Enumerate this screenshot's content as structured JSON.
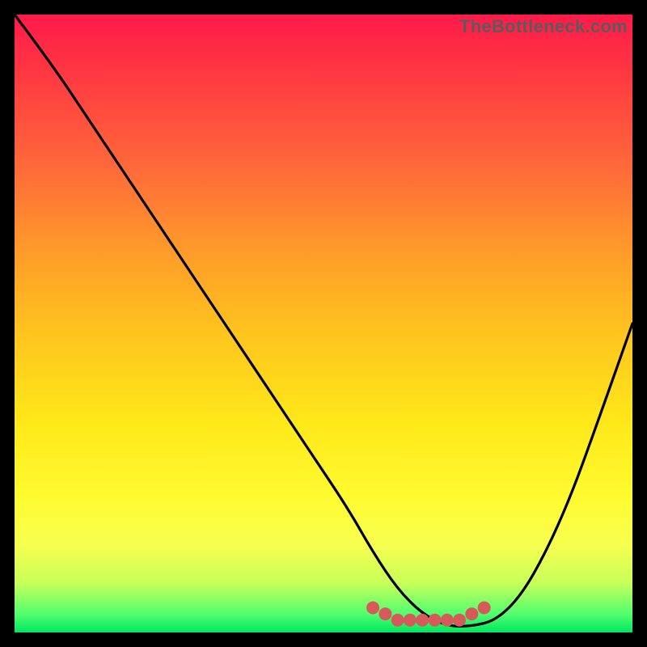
{
  "watermark": "TheBottleneck.com",
  "chart_data": {
    "type": "line",
    "title": "",
    "xlabel": "",
    "ylabel": "",
    "xlim": [
      0,
      100
    ],
    "ylim": [
      0,
      100
    ],
    "series": [
      {
        "name": "bottleneck-curve",
        "x": [
          0,
          6,
          12,
          18,
          24,
          30,
          36,
          42,
          48,
          54,
          58,
          62,
          66,
          70,
          74,
          78,
          82,
          86,
          90,
          94,
          100
        ],
        "values": [
          100,
          92,
          83,
          74,
          65,
          56,
          47,
          38,
          29,
          20,
          13,
          7,
          3,
          1,
          1,
          2,
          6,
          13,
          22,
          33,
          50
        ]
      }
    ],
    "markers": {
      "name": "curve-floor-dots",
      "color": "#d65a5a",
      "points": [
        {
          "x": 58,
          "y": 4
        },
        {
          "x": 60,
          "y": 3
        },
        {
          "x": 62,
          "y": 2
        },
        {
          "x": 64,
          "y": 2
        },
        {
          "x": 66,
          "y": 2
        },
        {
          "x": 68,
          "y": 2
        },
        {
          "x": 70,
          "y": 2
        },
        {
          "x": 72,
          "y": 2
        },
        {
          "x": 74,
          "y": 3
        },
        {
          "x": 76,
          "y": 4
        }
      ]
    }
  }
}
